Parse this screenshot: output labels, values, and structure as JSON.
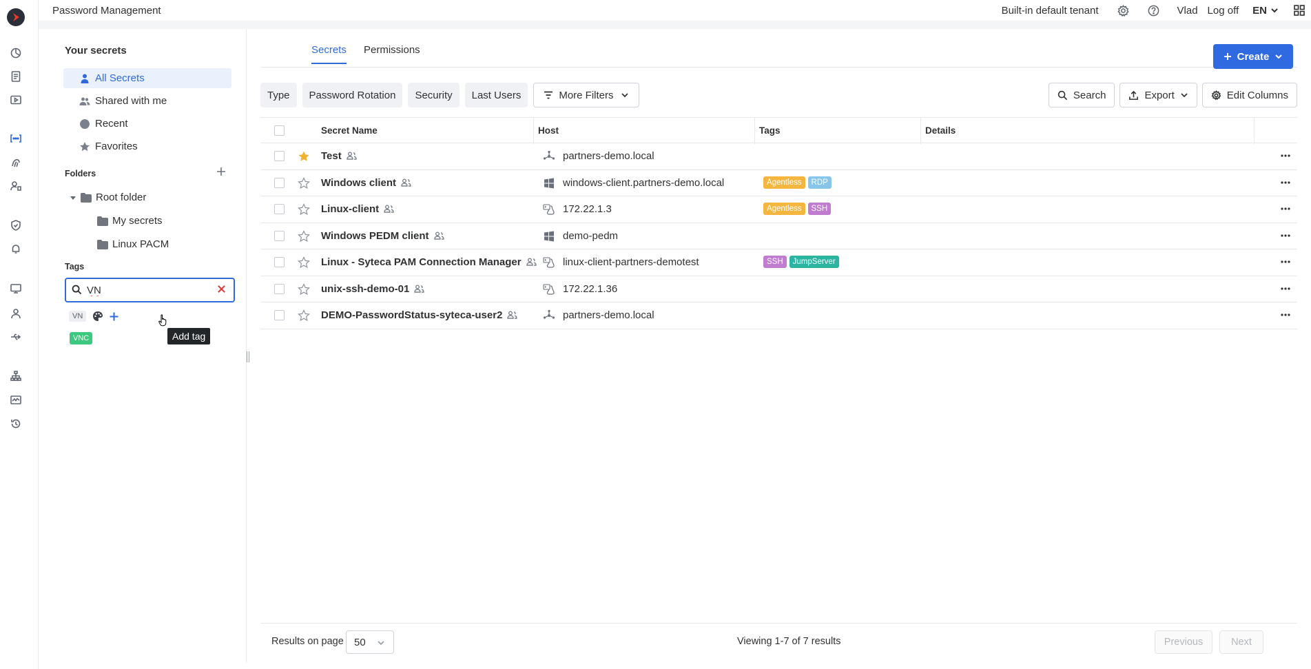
{
  "app": {
    "title": "Password Management"
  },
  "topbar": {
    "tenant": "Built-in default tenant",
    "user": "Vlad",
    "logoff": "Log off",
    "language": "EN"
  },
  "sidebar": {
    "title": "Your secrets",
    "items": [
      {
        "label": "All Secrets",
        "icon": "user-icon",
        "active": true
      },
      {
        "label": "Shared with me",
        "icon": "users-icon"
      },
      {
        "label": "Recent",
        "icon": "clock-icon"
      },
      {
        "label": "Favorites",
        "icon": "star-icon"
      }
    ],
    "folders_label": "Folders",
    "folders": {
      "root": "Root folder",
      "children": [
        "My secrets",
        "Linux PACM"
      ]
    },
    "tags_label": "Tags",
    "tag_search": {
      "value": "VN",
      "placeholder": ""
    },
    "new_tag": "VN",
    "tooltip": "Add tag",
    "existing_tags": [
      {
        "label": "VNC",
        "color": "#3cc87e"
      }
    ]
  },
  "tabs": [
    {
      "label": "Secrets",
      "active": true
    },
    {
      "label": "Permissions",
      "active": false
    }
  ],
  "create_label": "Create",
  "filters": [
    "Type",
    "Password Rotation",
    "Security",
    "Last Users"
  ],
  "more_filters": "More Filters",
  "actions": {
    "search": "Search",
    "export": "Export",
    "edit_columns": "Edit Columns"
  },
  "table": {
    "headers": {
      "name": "Secret Name",
      "host": "Host",
      "tags": "Tags",
      "details": "Details"
    },
    "rows": [
      {
        "name": "Test",
        "favorite": true,
        "host_icon": "network-icon",
        "host": "partners-demo.local",
        "tags": []
      },
      {
        "name": "Windows client",
        "favorite": false,
        "host_icon": "windows-icon",
        "host": "windows-client.partners-demo.local",
        "tags": [
          {
            "label": "Agentless",
            "color": "#f5b640"
          },
          {
            "label": "RDP",
            "color": "#87c5ea"
          }
        ]
      },
      {
        "name": "Linux-client",
        "favorite": false,
        "host_icon": "linux-terminal-icon",
        "host": "172.22.1.3",
        "tags": [
          {
            "label": "Agentless",
            "color": "#f5b640"
          },
          {
            "label": "SSH",
            "color": "#c07dd0"
          }
        ]
      },
      {
        "name": "Windows PEDM client",
        "favorite": false,
        "host_icon": "windows-icon",
        "host": "demo-pedm",
        "tags": []
      },
      {
        "name": "Linux - Syteca PAM Connection Manager",
        "favorite": false,
        "host_icon": "linux-terminal-icon",
        "host": "linux-client-partners-demotest",
        "tags": [
          {
            "label": "SSH",
            "color": "#c07dd0"
          },
          {
            "label": "JumpServer",
            "color": "#2bb5a0"
          }
        ]
      },
      {
        "name": "unix-ssh-demo-01",
        "favorite": false,
        "host_icon": "linux-terminal-icon",
        "host": "172.22.1.36",
        "tags": []
      },
      {
        "name": "DEMO-PasswordStatus-syteca-user2",
        "favorite": false,
        "host_icon": "network-icon",
        "host": "partners-demo.local",
        "tags": []
      }
    ]
  },
  "footer": {
    "results_label": "Results on page",
    "page_size": "50",
    "viewing": "Viewing 1-7 of 7 results",
    "previous": "Previous",
    "next": "Next"
  },
  "colors": {
    "accent": "#2e6bd9",
    "favorite_star": "#f2b230"
  }
}
